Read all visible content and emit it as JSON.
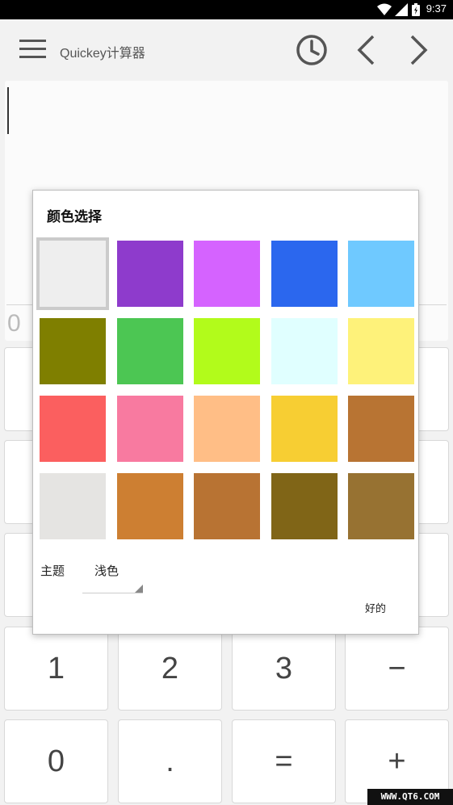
{
  "status_bar": {
    "time": "9:37",
    "icons": [
      "wifi-icon",
      "signal-icon",
      "battery-icon"
    ]
  },
  "app_bar": {
    "title": "Quickey计算器",
    "icons": [
      "hamburger-menu-icon",
      "history-clock-icon",
      "chevron-left-icon",
      "chevron-right-icon"
    ]
  },
  "display": {
    "value": "0"
  },
  "keys": {
    "row4": [
      "1",
      "2",
      "3",
      "−"
    ],
    "row5": [
      "0",
      ".",
      "=",
      "+"
    ]
  },
  "color_dialog": {
    "title": "颜色选择",
    "swatches": [
      "#eeeeee",
      "#8e3bcc",
      "#d563ff",
      "#2b67ee",
      "#6fc9ff",
      "#7f7f00",
      "#4cc653",
      "#b2fb1b",
      "#e0ffff",
      "#fef27a",
      "#fb5f5f",
      "#f87aa0",
      "#ffbe86",
      "#f7ce33",
      "#b87433",
      "#e5e4e2",
      "#cd7f32",
      "#b87333",
      "#806517",
      "#977232"
    ],
    "selected_index": 0,
    "theme_label": "主题",
    "theme_value": "浅色",
    "ok_label": "好的"
  },
  "watermark": "WWW.QT6.COM"
}
